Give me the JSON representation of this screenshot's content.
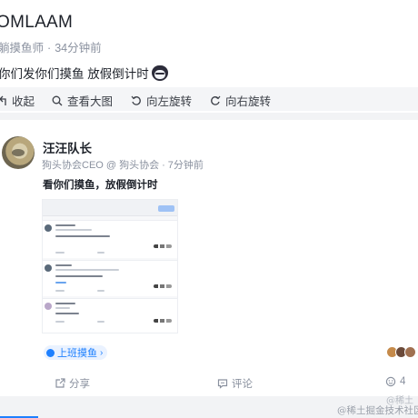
{
  "post": {
    "title": "OMLAAM",
    "meta_author": "躺摸鱼师",
    "meta_sep": "·",
    "meta_time": "34分钟前",
    "content": "你们发你们摸鱼 放假倒计时",
    "emoji": "cat-face-emoji"
  },
  "toolbar": {
    "collapse_label": "收起",
    "view_large_label": "查看大图",
    "rotate_left_label": "向左旋转",
    "rotate_right_label": "向右旋转"
  },
  "card": {
    "username": "汪汪队长",
    "user_title": "狗头协会CEO @ 狗头协会",
    "meta_sep": "·",
    "time": "7分钟前",
    "text": "看你们摸鱼，放假倒计时",
    "topic_tag": "上班摸鱼",
    "topic_chevron": "›",
    "actions": {
      "share_label": "分享",
      "comment_label": "评论",
      "like_count": "4"
    }
  },
  "watermark": {
    "line1": "@稀土",
    "line2": "@稀土掘金技术社区"
  },
  "colors": {
    "accent": "#1e80ff",
    "tag_bg": "#eaf2ff",
    "toolbar_bg": "#f4f5f7",
    "muted_text": "#8a919f"
  }
}
